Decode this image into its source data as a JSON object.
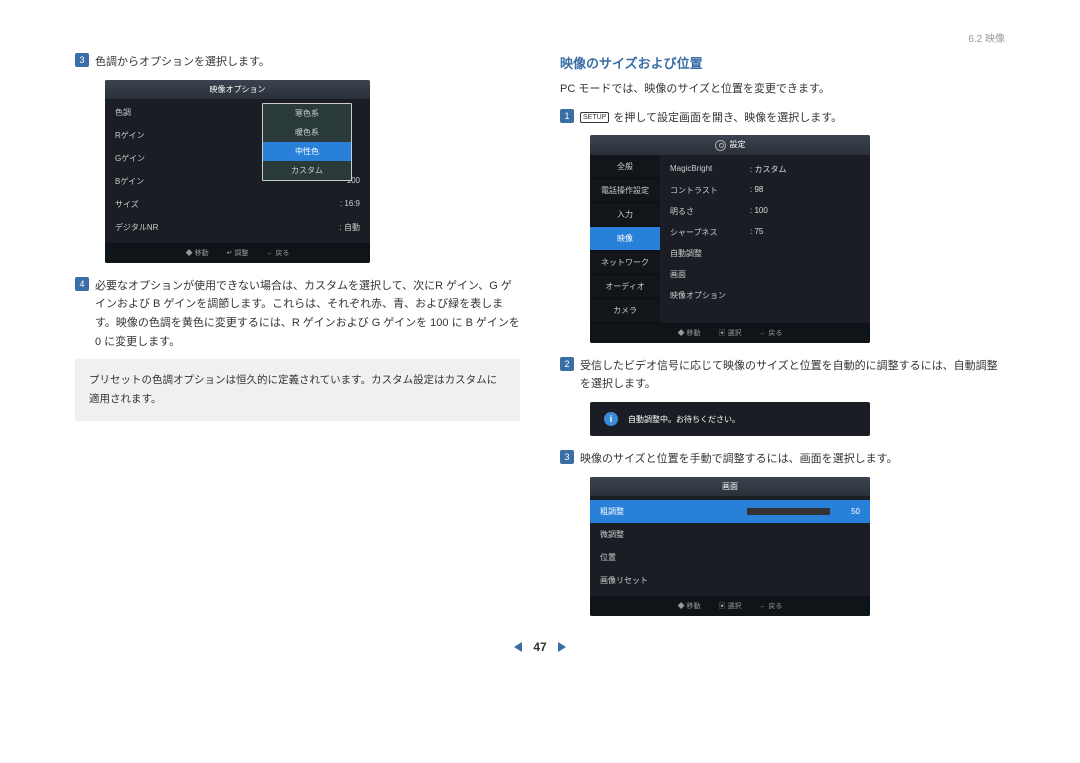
{
  "header": {
    "section_ref": "6.2 映像"
  },
  "left": {
    "step3_text": "色調からオプションを選択します。",
    "osd1": {
      "title": "映像オプション",
      "items": [
        {
          "label": "色調",
          "value": ""
        },
        {
          "label": "Rゲイン",
          "value": ""
        },
        {
          "label": "Gゲイン",
          "value": ""
        },
        {
          "label": "Bゲイン",
          "value": "100"
        },
        {
          "label": "サイズ",
          "value": ": 16:9"
        },
        {
          "label": "デジタルNR",
          "value": ": 自動"
        }
      ],
      "popup": [
        "寒色系",
        "暖色系",
        "中性色",
        "カスタム"
      ],
      "footer": {
        "move": "移動",
        "adjust": "調整",
        "back": "戻る"
      }
    },
    "step4_text": "必要なオプションが使用できない場合は、カスタムを選択して、次にR ゲイン、G ゲインおよび B ゲインを調節します。これらは、それぞれ赤、青、および緑を表します。映像の色調を黄色に変更するには、R ゲインおよび G ゲインを 100 に B ゲインを 0 に変更します。",
    "note": "プリセットの色調オプションは恒久的に定義されています。カスタム設定はカスタムに適用されます。"
  },
  "right": {
    "section_title": "映像のサイズおよび位置",
    "intro": "PC モードでは、映像のサイズと位置を変更できます。",
    "step1_key": "SETUP",
    "step1_text": "を押して設定画面を開き、映像を選択します。",
    "osd2": {
      "title": "設定",
      "left_items": [
        "全般",
        "電話操作設定",
        "入力",
        "映像",
        "ネットワーク",
        "オーディオ",
        "カメラ"
      ],
      "active_index": 3,
      "right_items": [
        {
          "label": "MagicBright",
          "value": ": カスタム"
        },
        {
          "label": "コントラスト",
          "value": ": 98"
        },
        {
          "label": "明るさ",
          "value": ": 100"
        },
        {
          "label": "シャープネス",
          "value": ": 75"
        },
        {
          "label": "自動調整",
          "value": ""
        },
        {
          "label": "画面",
          "value": ""
        },
        {
          "label": "映像オプション",
          "value": ""
        }
      ],
      "footer": {
        "move": "移動",
        "select": "選択",
        "back": "戻る"
      }
    },
    "step2_text": "受信したビデオ信号に応じて映像のサイズと位置を自動的に調整するには、自動調整を選択します。",
    "info_bar": "自動調整中。お待ちください。",
    "step3_text": "映像のサイズと位置を手動で調整するには、画面を選択します。",
    "osd3": {
      "title": "画面",
      "rows": [
        {
          "label": "粗調整",
          "value": "50",
          "slider": 50
        },
        {
          "label": "微調整",
          "value": ""
        },
        {
          "label": "位置",
          "value": ""
        },
        {
          "label": "画像リセット",
          "value": ""
        }
      ],
      "footer": {
        "move": "移動",
        "select": "選択",
        "back": "戻る"
      }
    }
  },
  "pager": {
    "num": "47"
  }
}
